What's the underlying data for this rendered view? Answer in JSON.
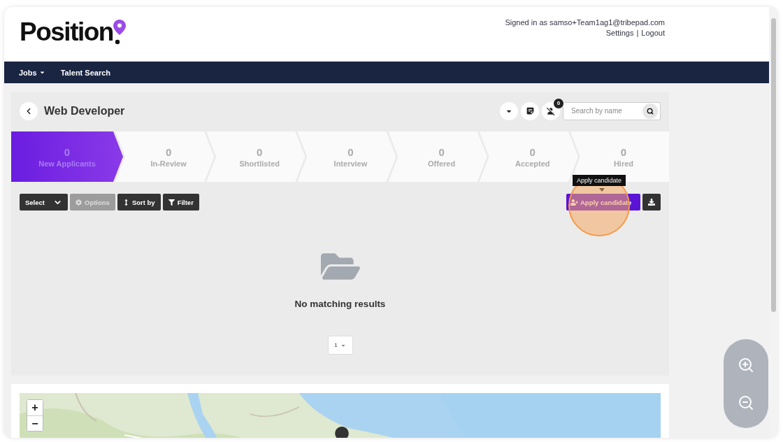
{
  "header": {
    "logo": "Position",
    "signed_in": "Signed in as samso+Team1ag1@tribepad.com",
    "links": [
      "Settings",
      "Logout"
    ],
    "separator": "|"
  },
  "nav": [
    {
      "label": "Jobs",
      "dropdown": true
    },
    {
      "label": "Talent Search",
      "dropdown": false
    }
  ],
  "job": {
    "title": "Web Developer",
    "badge": "0",
    "search": {
      "placeholder": "Search by name"
    }
  },
  "stages": [
    {
      "count": "0",
      "label": "New Applicants",
      "selected": true
    },
    {
      "count": "0",
      "label": "In-Review",
      "selected": false
    },
    {
      "count": "0",
      "label": "Shortlisted",
      "selected": false
    },
    {
      "count": "0",
      "label": "Interview",
      "selected": false
    },
    {
      "count": "0",
      "label": "Offered",
      "selected": false
    },
    {
      "count": "0",
      "label": "Accepted",
      "selected": false
    },
    {
      "count": "0",
      "label": "Hired",
      "selected": false
    }
  ],
  "toolbar": {
    "buttons": [
      {
        "kind": "select",
        "label": "Select",
        "disabled": false
      },
      {
        "kind": "options",
        "label": "Options",
        "disabled": true
      },
      {
        "kind": "sort",
        "label": "Sort by",
        "disabled": false
      },
      {
        "kind": "filter",
        "label": "Filter",
        "disabled": false
      }
    ],
    "apply": {
      "label": "Apply candidate",
      "tooltip": "Apply candidate"
    }
  },
  "empty": {
    "message": "No matching results",
    "page": "1"
  },
  "map": {
    "kind": "picture",
    "zoom_in": "+",
    "zoom_out": "−"
  }
}
